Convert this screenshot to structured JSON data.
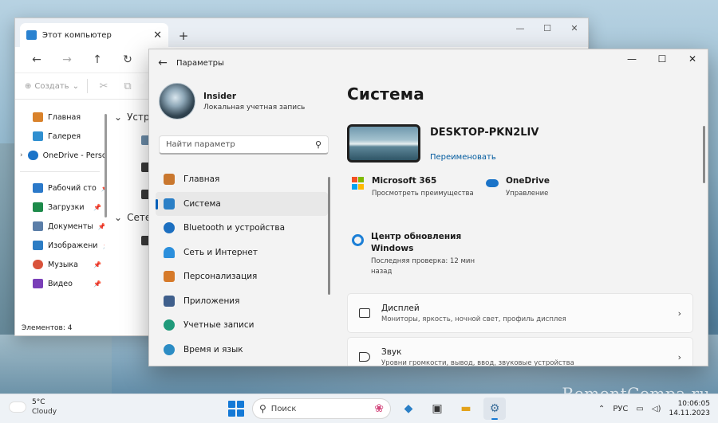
{
  "explorer": {
    "tab_title": "Этот компьютер",
    "create_label": "Создать",
    "sidebar": [
      {
        "label": "Главная",
        "color": "#d9822b",
        "pinned": false,
        "expand": false
      },
      {
        "label": "Галерея",
        "color": "#2f8fd0",
        "pinned": false,
        "expand": false
      },
      {
        "label": "OneDrive - Perso",
        "color": "#1a73c8",
        "pinned": false,
        "expand": true
      },
      {
        "label": "Рабочий сто",
        "color": "#2b79c9",
        "pinned": true,
        "expand": false
      },
      {
        "label": "Загрузки",
        "color": "#1d8a4a",
        "pinned": true,
        "expand": false
      },
      {
        "label": "Документы",
        "color": "#5b7ea8",
        "pinned": true,
        "expand": false
      },
      {
        "label": "Изображени",
        "color": "#2c7cc4",
        "pinned": true,
        "expand": false
      },
      {
        "label": "Музыка",
        "color": "#d9533b",
        "pinned": true,
        "expand": false
      },
      {
        "label": "Видео",
        "color": "#7a3fb8",
        "pinned": true,
        "expand": false
      }
    ],
    "groups": [
      "Устро",
      "Сетев"
    ],
    "status": "Элементов: 4"
  },
  "settings": {
    "title": "Параметры",
    "user_name": "Insider",
    "account_type": "Локальная учетная запись",
    "search_placeholder": "Найти параметр",
    "nav": [
      {
        "label": "Главная",
        "color": "#c9772e"
      },
      {
        "label": "Система",
        "color": "#2a7fc6"
      },
      {
        "label": "Bluetooth и устройства",
        "color": "#1c6fc0"
      },
      {
        "label": "Сеть и Интернет",
        "color": "#2b8fdc"
      },
      {
        "label": "Персонализация",
        "color": "#d67a2a"
      },
      {
        "label": "Приложения",
        "color": "#3f5f8c"
      },
      {
        "label": "Учетные записи",
        "color": "#1f9a7a"
      },
      {
        "label": "Время и язык",
        "color": "#2b8cc4"
      }
    ],
    "page_title": "Система",
    "device_name": "DESKTOP-PKN2LIV",
    "rename_label": "Переименовать",
    "tiles": {
      "m365_title": "Microsoft 365",
      "m365_sub": "Просмотреть преимущества",
      "onedrive_title": "OneDrive",
      "onedrive_sub": "Управление",
      "update_title": "Центр обновления Windows",
      "update_sub": "Последняя проверка: 12 мин назад"
    },
    "cards": [
      {
        "title": "Дисплей",
        "subtitle": "Мониторы, яркость, ночной свет, профиль дисплея"
      },
      {
        "title": "Звук",
        "subtitle": "Уровни громкости, вывод, ввод, звуковые устройства"
      }
    ]
  },
  "taskbar": {
    "temperature": "5°C",
    "condition": "Cloudy",
    "search_label": "Поиск",
    "language": "РУС",
    "time": "10:06:05",
    "date": "14.11.2023"
  },
  "watermark": "RemontCompa.ru"
}
